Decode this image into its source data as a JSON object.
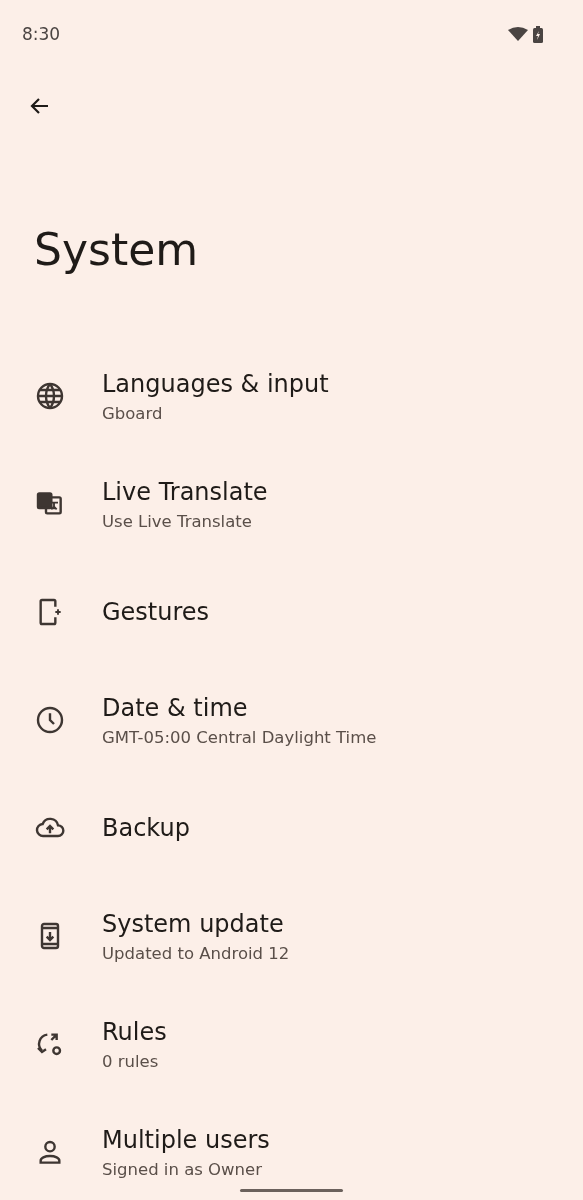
{
  "status_bar": {
    "time": "8:30"
  },
  "title": "System",
  "items": [
    {
      "kind": "globe",
      "title": "Languages & input",
      "subtitle": "Gboard"
    },
    {
      "kind": "translate",
      "title": "Live Translate",
      "subtitle": "Use Live Translate"
    },
    {
      "kind": "gestures",
      "title": "Gestures"
    },
    {
      "kind": "clock",
      "title": "Date & time",
      "subtitle": "GMT-05:00 Central Daylight Time"
    },
    {
      "kind": "backup",
      "title": "Backup"
    },
    {
      "kind": "update",
      "title": "System update",
      "subtitle": "Updated to Android 12"
    },
    {
      "kind": "rules",
      "title": "Rules",
      "subtitle": "0 rules"
    },
    {
      "kind": "user",
      "title": "Multiple users",
      "subtitle": "Signed in as Owner"
    }
  ]
}
